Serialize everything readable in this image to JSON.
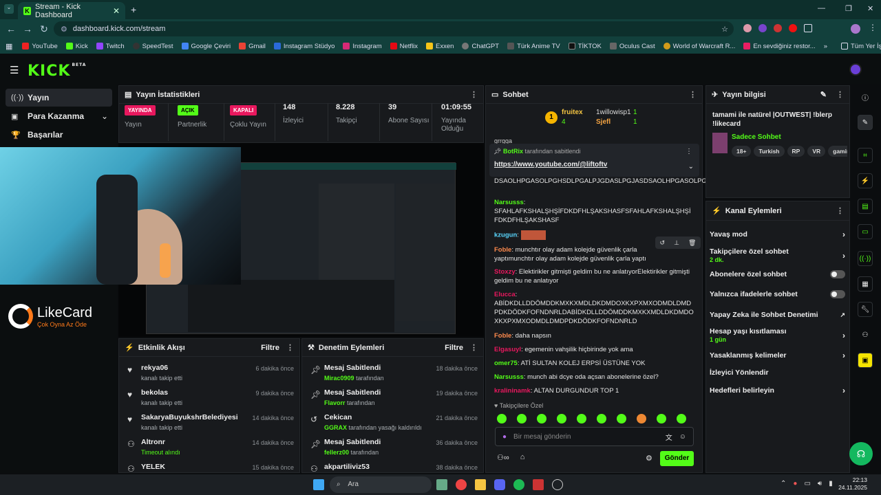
{
  "browser": {
    "tab_title": "Stream - Kick Dashboard",
    "url": "dashboard.kick.com/stream",
    "bookmarks": [
      "YouTube",
      "Kick",
      "Twitch",
      "SpeedTest",
      "Google Çeviri",
      "Gmail",
      "Instagram Stüdyo",
      "Instagram",
      "Netflix",
      "Exxen",
      "ChatGPT",
      "Türk Anime TV",
      "TİKTOK",
      "Oculus Cast",
      "World of Warcraft R...",
      "En sevdiğiniz restor..."
    ],
    "all_bookmarks": "Tüm Yer İşaretleri"
  },
  "kick": {
    "logo": "KICK",
    "beta": "BETA",
    "nav": [
      {
        "label": "Yayın"
      },
      {
        "label": "Para Kazanma"
      },
      {
        "label": "Başarılar"
      }
    ]
  },
  "stats": {
    "title": "Yayın İstatistikleri",
    "items": [
      {
        "badge": "YAYINDA",
        "label": "Yayın",
        "color": "#e8185e"
      },
      {
        "badge": "AÇIK",
        "label": "Partnerlik",
        "color": "#53fc18"
      },
      {
        "badge": "KAPALI",
        "label": "Çoklu Yayın",
        "color": "#e8185e"
      },
      {
        "value": "148",
        "label": "İzleyici"
      },
      {
        "value": "8.228",
        "label": "Takipçi"
      },
      {
        "value": "39",
        "label": "Abone Sayısı"
      },
      {
        "value": "01:09:55",
        "label": "Yayında Olduğu"
      }
    ]
  },
  "overlay": {
    "brand": "LikeCard",
    "tagline": "Çok Oyna Az Öde"
  },
  "activity": {
    "title": "Etkinlik Akışı",
    "filter": "Filtre",
    "items": [
      {
        "name": "rekya06",
        "sub": "kanalı takip etti",
        "time": "6 dakika önce"
      },
      {
        "name": "bekolas",
        "sub": "kanalı takip etti",
        "time": "9 dakika önce"
      },
      {
        "name": "SakaryaBuyukshrBelediyesi",
        "sub": "kanalı takip etti",
        "time": "14 dakika önce"
      },
      {
        "name": "Altronr",
        "sub": "Timeout alındı",
        "time": "14 dakika önce"
      },
      {
        "name": "YELEK",
        "sub": "",
        "time": "15 dakika önce"
      }
    ]
  },
  "moderation": {
    "title": "Denetim Eylemleri",
    "filter": "Filtre",
    "items": [
      {
        "name": "Mesaj Sabitlendi",
        "who": "Mirac0909",
        "rest": "tarafından",
        "time": "18 dakika önce"
      },
      {
        "name": "Mesaj Sabitlendi",
        "who": "Flavorr",
        "rest": "tarafından",
        "time": "19 dakika önce"
      },
      {
        "name": "Cekican",
        "who": "GGRAX",
        "rest": "tarafından yasağı kaldırıldı",
        "time": "21 dakika önce"
      },
      {
        "name": "Mesaj Sabitlendi",
        "who": "fellerz00",
        "rest": "tarafından",
        "time": "36 dakika önce"
      },
      {
        "name": "akpartiliviz53",
        "who": "",
        "rest": "",
        "time": "38 dakika önce"
      }
    ]
  },
  "chat": {
    "title": "Sohbet",
    "top": {
      "first": "fruitex",
      "first_count": "4",
      "second": "1willowisp1",
      "second_count": "1",
      "third": "Sjefl",
      "third_count": "1"
    },
    "pinned": {
      "by": "BotRix",
      "by_suffix": "tarafından sabitlendi",
      "link": "https://www.youtube.com/@liftoftv"
    },
    "cut_top": "grrgga",
    "spam_tail": "DSAOLHPGASOLPGHSDLPGALPJGDASLPGJASDSAOLHPGASOLPGHSDLPGALPJGDASLPGJAS",
    "messages": [
      {
        "user": "Narsusss",
        "color": "#53fc18",
        "text": "SFAHLAFKSHALŞHŞİFDKDFHLŞAKSHASFSFAHLAFKSHALŞHŞİFDKDFHLŞAKSHASF"
      },
      {
        "user": "kzugun",
        "color": "#5ad7ff",
        "text": ""
      },
      {
        "user": "Foble",
        "color": "#ff8a4d",
        "text": "munchtır olay adam kolejde güvenlik çarla yaptımunchtır olay adam kolejde güvenlik çarla yaptı"
      },
      {
        "user": "Stoxzy",
        "color": "#e8185e",
        "text": "Elektirikler gitmişti geldim bu ne anlatıyorElektirikler gitmişti geldim bu ne anlatıyor"
      },
      {
        "user": "Elucca",
        "color": "#e8185e",
        "text": "ABİDKDLLDDÖMDDKMXKXMDLDKDMDOXKXPXMXODMDLDMDPDKDÖDKFOFNDNRLDABİDKDLLDDÖMDDKMXKXMDLDKDMDOXKXPXMXODMDLDMDPDKDÖDKFOFNDNRLD"
      },
      {
        "user": "Foble",
        "color": "#ff8a4d",
        "text": "daha napsın"
      },
      {
        "user": "Elgasuyl",
        "color": "#e8185e",
        "text": "egemenin vahşilik hiçbirinde yok ama"
      },
      {
        "user": "omer75",
        "color": "#53fc18",
        "text": "ATİ SULTAN KOLEJ ERPSİ ÜSTÜNE YOK"
      },
      {
        "user": "Narsusss",
        "color": "#53fc18",
        "text": "munch abi dcye oda açsan abonelerine özel?"
      },
      {
        "user": "kralininamk",
        "color": "#e8185e",
        "text": "ALTAN DURGUNDUR TOP 1"
      }
    ],
    "mode": "Takipçilere Özel",
    "placeholder": "Bir mesaj gönderin",
    "send": "Gönder"
  },
  "info": {
    "title": "Yayın bilgisi",
    "stream_title": "tamami ile natürel |OUTWEST| !blerp !likecard",
    "category": "Sadece Sohbet",
    "tags": [
      "18+",
      "Turkish",
      "RP",
      "VR",
      "gaming"
    ]
  },
  "channel": {
    "title": "Kanal Eylemleri",
    "rows": [
      {
        "label": "Yavaş mod",
        "type": "arrow"
      },
      {
        "label": "Takipçilere özel sohbet",
        "sub": "2 dk.",
        "type": "arrow"
      },
      {
        "label": "Abonelere özel sohbet",
        "type": "toggle"
      },
      {
        "label": "Yalnızca ifadelerle sohbet",
        "type": "toggle"
      },
      {
        "label": "Yapay Zeka ile Sohbet Denetimi",
        "type": "link"
      },
      {
        "label": "Hesap yaşı kısıtlaması",
        "sub": "1 gün",
        "type": "arrow"
      },
      {
        "label": "Yasaklanmış kelimeler",
        "type": "arrow"
      },
      {
        "label": "İzleyici Yönlendir",
        "type": "none"
      },
      {
        "label": "Hedefleri belirleyin",
        "type": "arrow"
      }
    ]
  },
  "taskbar": {
    "search": "Ara",
    "time": "22:13",
    "date": "24.11.2025"
  }
}
